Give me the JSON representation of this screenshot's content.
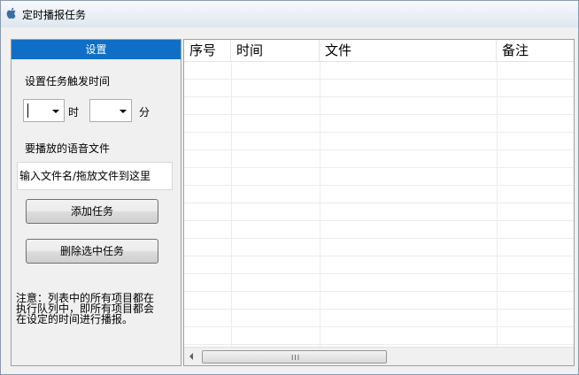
{
  "window": {
    "title": "定时播报任务"
  },
  "settings": {
    "header": "设置",
    "trigger_label": "设置任务触发时间",
    "hour_value": "",
    "hour_unit": "时",
    "minute_value": "",
    "minute_unit": "分",
    "file_label": "要播放的语音文件",
    "file_placeholder": "输入文件名/拖放文件到这里",
    "add_button": "添加任务",
    "delete_button": "删除选中任务",
    "note_lines": [
      "注意：列表中的所有项目都在",
      "执行队列中，即所有项目都会",
      "在设定的时间进行播报。"
    ]
  },
  "task_list": {
    "columns": [
      "序号",
      "时间",
      "文件",
      "备注"
    ],
    "rows": []
  },
  "scrollbar": {
    "grip": "III"
  },
  "colors": {
    "header_blue": "#0f6fc6"
  }
}
